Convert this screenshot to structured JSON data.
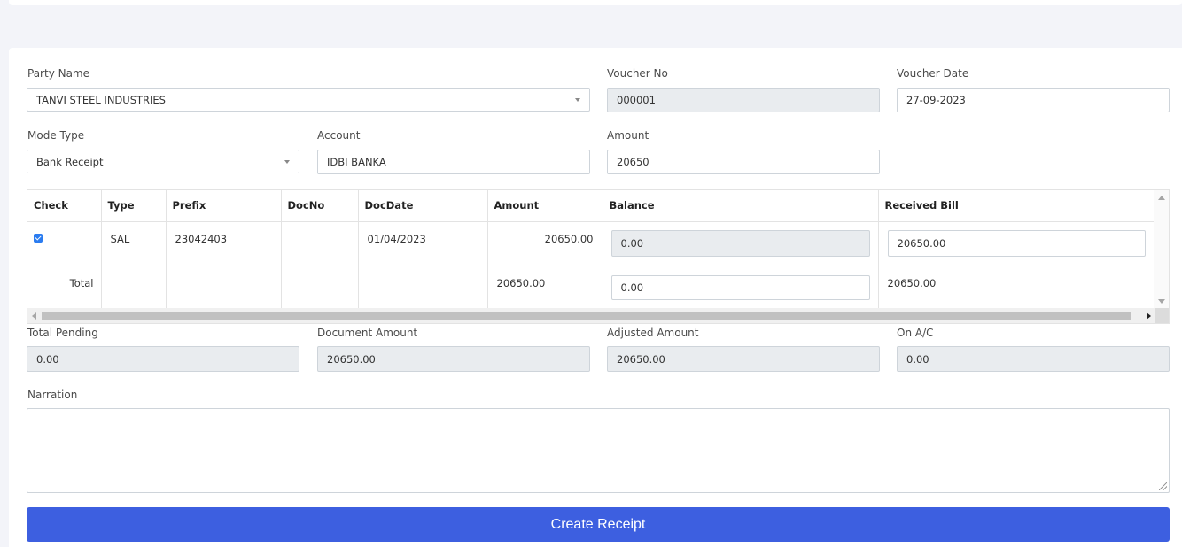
{
  "form": {
    "party_name": {
      "label": "Party Name",
      "value": "TANVI STEEL INDUSTRIES"
    },
    "voucher_no": {
      "label": "Voucher No",
      "value": "000001"
    },
    "voucher_date": {
      "label": "Voucher Date",
      "value": "27-09-2023"
    },
    "mode_type": {
      "label": "Mode Type",
      "value": "Bank Receipt"
    },
    "account": {
      "label": "Account",
      "value": "IDBI BANKA"
    },
    "amount": {
      "label": "Amount",
      "value": "20650"
    }
  },
  "grid": {
    "columns": [
      "Check",
      "Type",
      "Prefix",
      "DocNo",
      "DocDate",
      "Amount",
      "Balance",
      "Received Bill"
    ],
    "rows": [
      {
        "checked": true,
        "type": "SAL",
        "prefix": "23042403",
        "doc_no": "",
        "doc_date": "01/04/2023",
        "amount": "20650.00",
        "balance": "0.00",
        "received_bill": "20650.00"
      }
    ],
    "total": {
      "label": "Total",
      "amount": "20650.00",
      "balance": "0.00",
      "received_bill": "20650.00"
    }
  },
  "summary": {
    "total_pending": {
      "label": "Total Pending",
      "value": "0.00"
    },
    "document_amount": {
      "label": "Document Amount",
      "value": "20650.00"
    },
    "adjusted_amount": {
      "label": "Adjusted Amount",
      "value": "20650.00"
    },
    "on_ac": {
      "label": "On A/C",
      "value": "0.00"
    }
  },
  "narration": {
    "label": "Narration",
    "value": ""
  },
  "actions": {
    "create_label": "Create Receipt"
  },
  "colors": {
    "primary": "#3d5fe0",
    "readonly_bg": "#e9ecef",
    "checkbox": "#2b7cf0"
  }
}
